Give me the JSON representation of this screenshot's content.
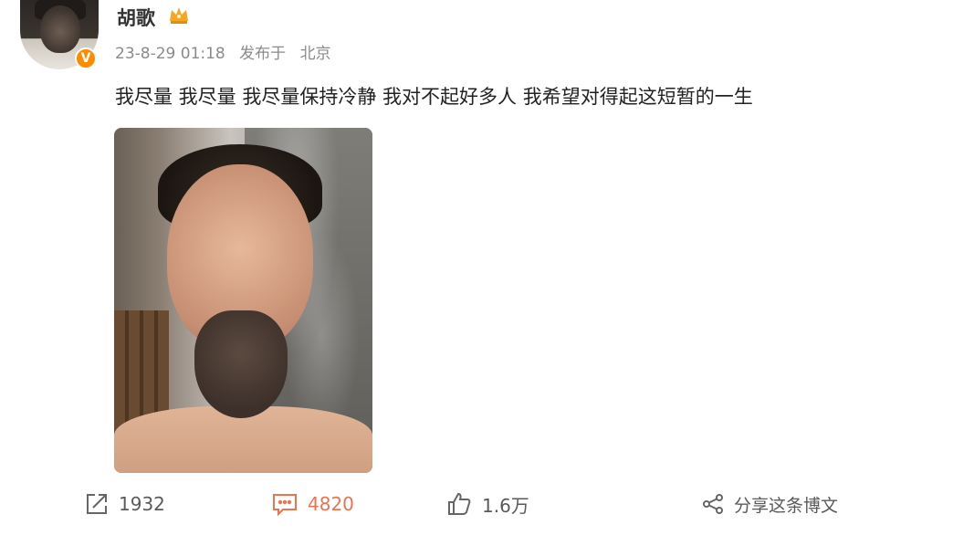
{
  "user": {
    "name": "胡歌",
    "verified_badge": "V"
  },
  "post": {
    "time": "23-8-29 01:18",
    "location_prefix": "发布于",
    "location": "北京",
    "text": "我尽量 我尽量 我尽量保持冷静 我对不起好多人 我希望对得起这短暂的一生"
  },
  "actions": {
    "repost_count": "1932",
    "comment_count": "4820",
    "like_count": "1.6万",
    "share_label": "分享这条博文"
  },
  "colors": {
    "accent_orange": "#eb7350",
    "badge_orange": "#ff8a00",
    "crown_gold": "#f5a623",
    "meta_gray": "#8b8b8b"
  },
  "icons": [
    "repost-icon",
    "comment-icon",
    "like-icon",
    "share-icon",
    "crown-icon"
  ]
}
